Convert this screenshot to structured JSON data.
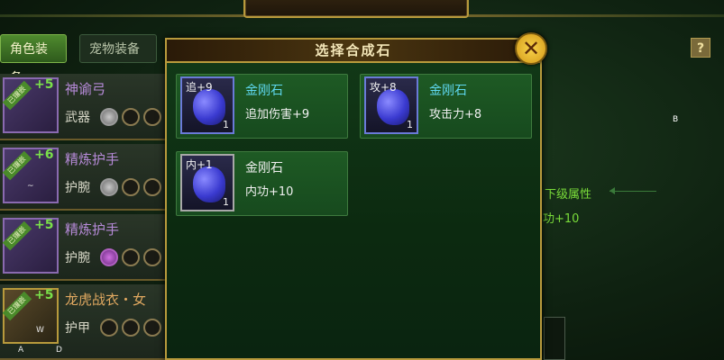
{
  "tabs": {
    "character_equip": "角色装备",
    "pet_equip": "宠物装备"
  },
  "equipment": [
    {
      "name": "神谕弓",
      "type": "武器",
      "plus": "+5",
      "ribbon": "已镶嵌",
      "rarity": "purple",
      "slots": [
        "filled",
        "empty",
        "empty"
      ]
    },
    {
      "name": "精炼护手",
      "type": "护腕",
      "plus": "+6",
      "ribbon": "已镶嵌",
      "rarity": "purple",
      "slots": [
        "filled",
        "empty",
        "empty"
      ]
    },
    {
      "name": "精炼护手",
      "type": "护腕",
      "plus": "+5",
      "ribbon": "已镶嵌",
      "rarity": "purple",
      "slots": [
        "purple",
        "empty",
        "empty"
      ]
    },
    {
      "name": "龙虎战衣・女",
      "type": "护甲",
      "plus": "+5",
      "ribbon": "已镶嵌",
      "rarity": "gold",
      "slots": [
        "empty",
        "empty",
        "empty"
      ]
    }
  ],
  "overlay_letters": {
    "w": "W",
    "a": "A",
    "d": "D",
    "b": "B",
    "tilde": "~"
  },
  "dialog": {
    "title": "选择合成石",
    "close": "✕"
  },
  "stones": [
    {
      "tag": "追+9",
      "name": "金刚石",
      "stat": "追加伤害+9",
      "qty": "1",
      "selected": true
    },
    {
      "tag": "攻+8",
      "name": "金刚石",
      "stat": "攻击力+8",
      "qty": "1",
      "selected": true
    },
    {
      "tag": "内+1",
      "name": "金刚石",
      "stat": "内功+10",
      "qty": "1",
      "selected": false
    }
  ],
  "right_panel": {
    "help": "?",
    "next_attr_label": "下级属性",
    "next_attr_value": "功+10"
  }
}
